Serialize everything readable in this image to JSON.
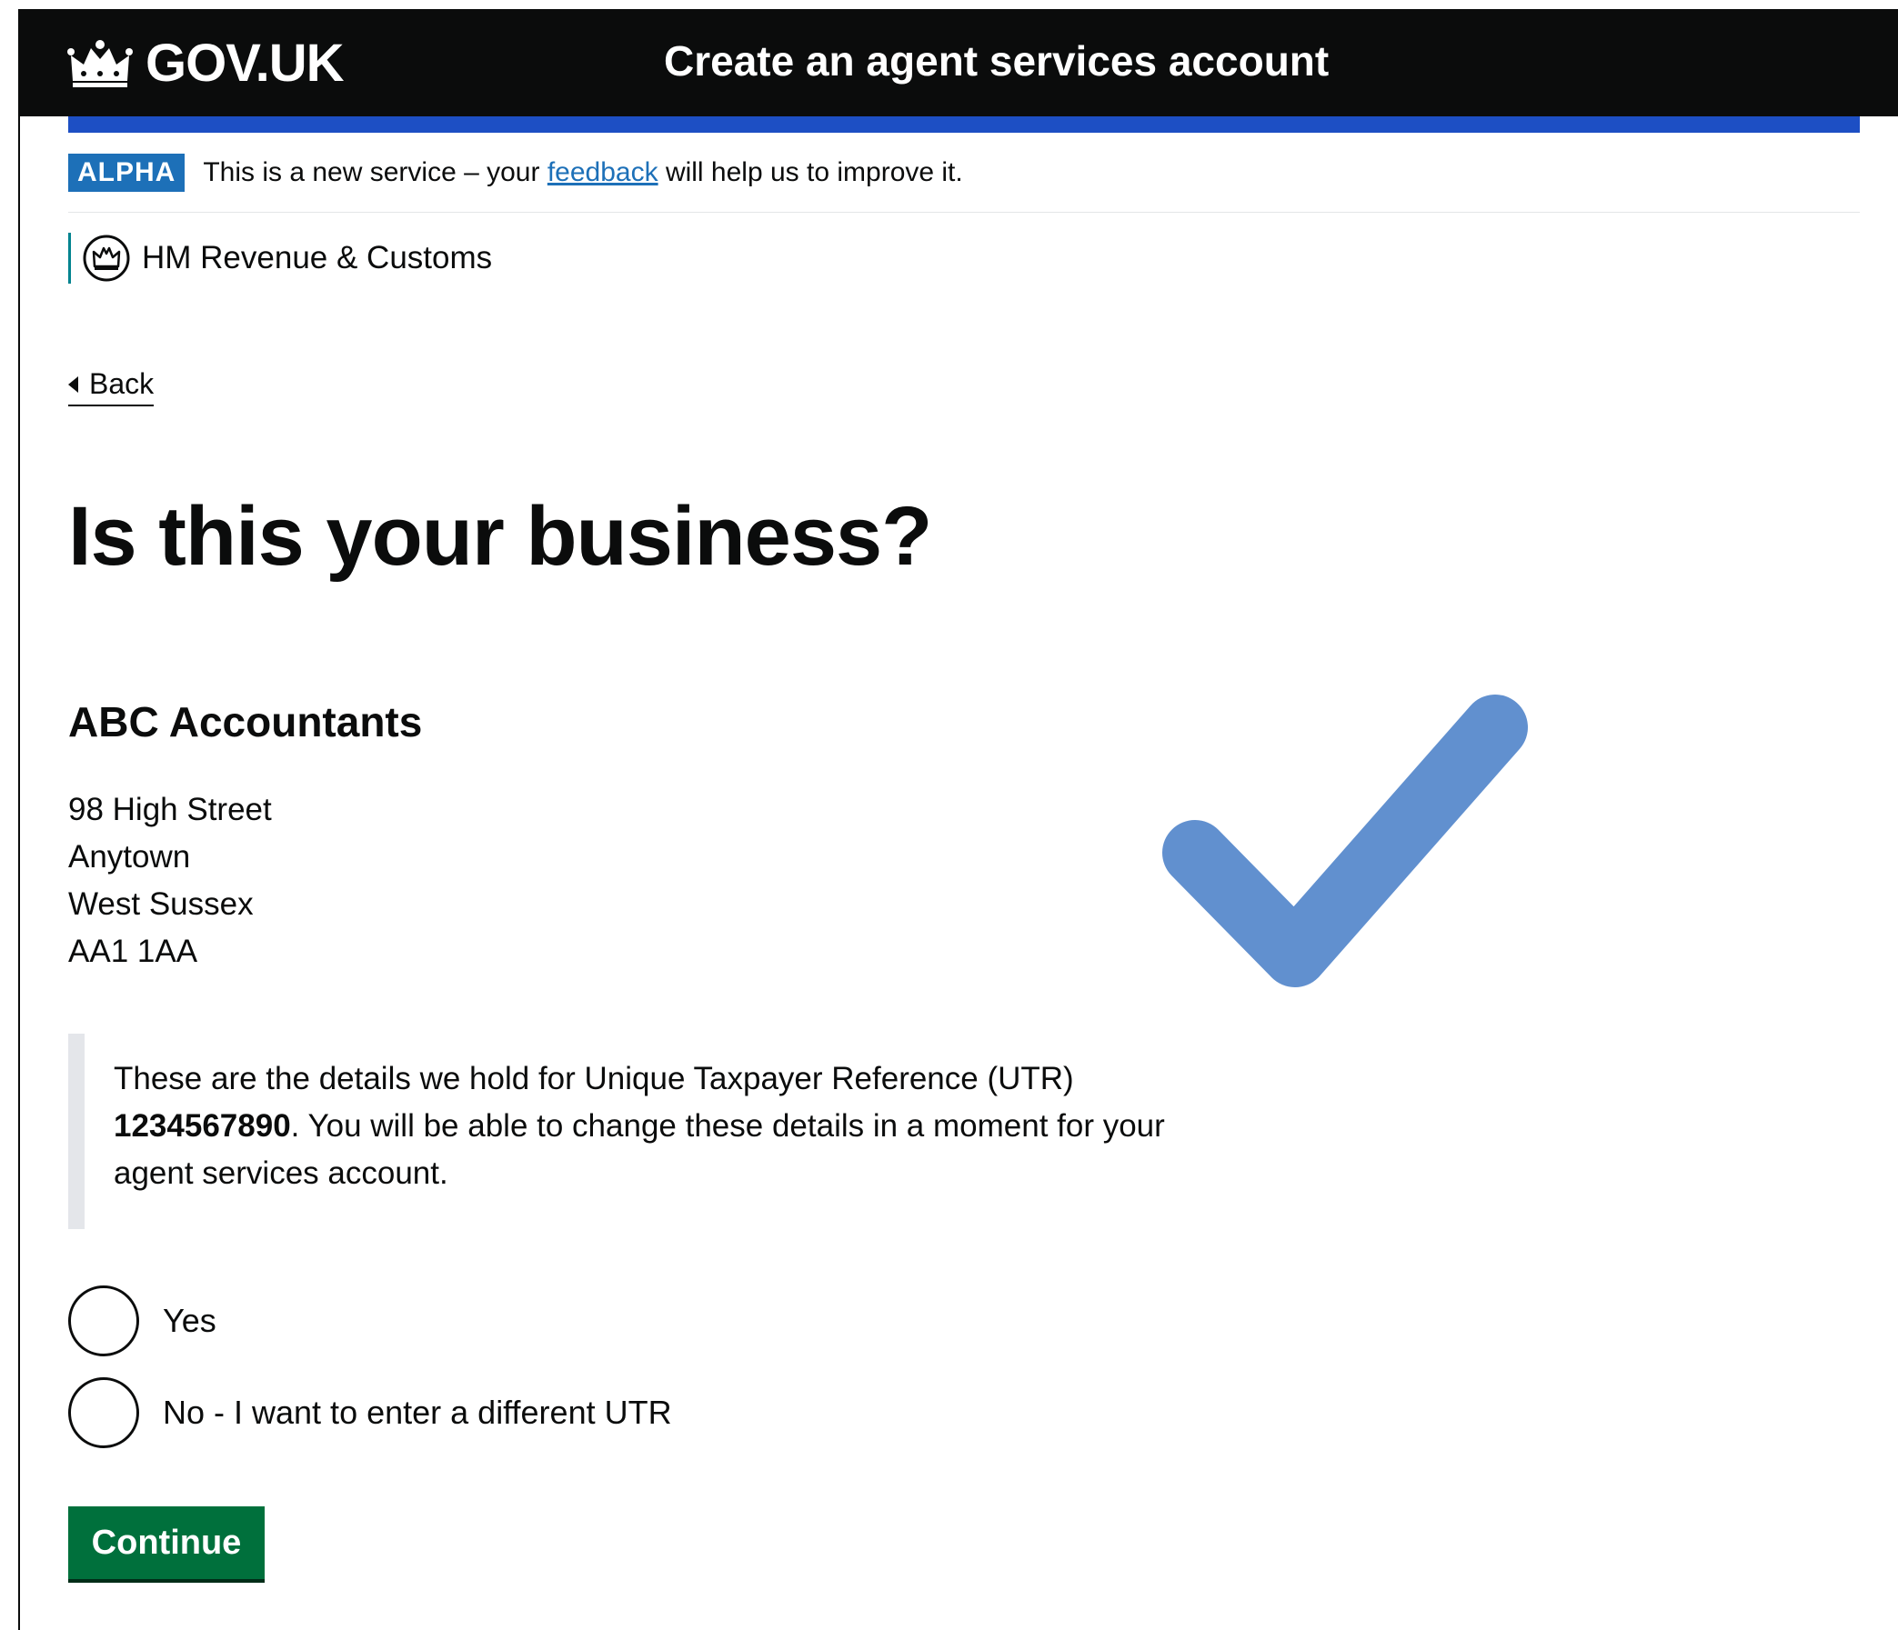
{
  "header": {
    "logo_text": "GOV.UK",
    "service_name": "Create an agent services account"
  },
  "phase_banner": {
    "tag": "ALPHA",
    "text_before": "This is a new service – your",
    "link_text": "feedback",
    "text_after": "will help us to improve it."
  },
  "organisation": {
    "name": "HM Revenue & Customs"
  },
  "back_link": "Back",
  "page_title": "Is this your business?",
  "business": {
    "name": "ABC Accountants",
    "address": [
      "98 High Street",
      "Anytown",
      "West Sussex",
      "AA1 1AA"
    ]
  },
  "inset": {
    "text_before": "These are the details we hold for Unique Taxpayer Reference (UTR)",
    "utr": "1234567890",
    "text_after": ". You will be able to change these details in a moment for your agent services account."
  },
  "radios": [
    {
      "label": "Yes",
      "selected": false
    },
    {
      "label": "No - I want to enter a different UTR",
      "selected": false
    }
  ],
  "continue_label": "Continue",
  "colors": {
    "header": "#0b0c0c",
    "blue_bar": "#1d4fc4",
    "phase_tag": "#1d70b8",
    "link": "#1d70b8",
    "org_border": "#00838f",
    "button": "#00703c",
    "tick": "#6190cf"
  },
  "icons": {
    "logo": "crown-icon",
    "organisation": "crest-icon",
    "back": "triangle-left-icon",
    "overlay": "checkmark-icon"
  }
}
